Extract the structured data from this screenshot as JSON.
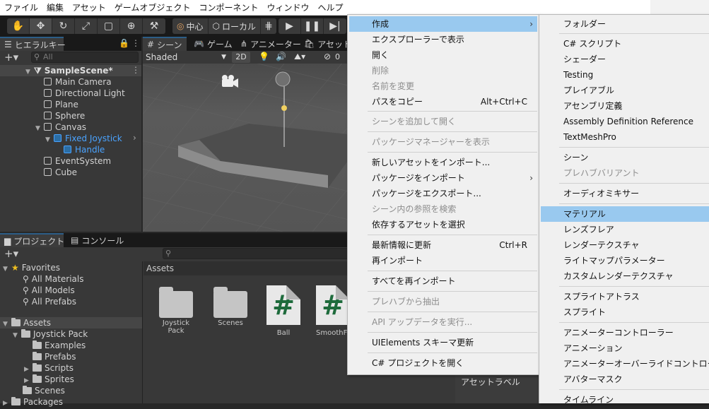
{
  "menubar": {
    "items": [
      "ファイル",
      "編集",
      "アセット",
      "ゲームオブジェクト",
      "コンポーネント",
      "ウィンドウ",
      "ヘルプ"
    ]
  },
  "toolbar": {
    "pivot_label": "中心",
    "space_label": "ローカル"
  },
  "hierarchy": {
    "tab": "ヒエラルキー",
    "search_placeholder": "All",
    "scene_name": "SampleScene*",
    "items": [
      {
        "label": "Main Camera"
      },
      {
        "label": "Directional Light"
      },
      {
        "label": "Plane"
      },
      {
        "label": "Sphere"
      },
      {
        "label": "Canvas"
      },
      {
        "label": "Fixed Joystick"
      },
      {
        "label": "Handle"
      },
      {
        "label": "EventSystem"
      },
      {
        "label": "Cube"
      }
    ]
  },
  "scene_view": {
    "tabs": [
      "シーン",
      "ゲーム",
      "アニメーター",
      "アセットス"
    ],
    "shading_mode": "Shaded",
    "mode_2d": "2D",
    "hidden_count": "0"
  },
  "project": {
    "tabs": [
      "プロジェクト",
      "コンソール"
    ],
    "favorites_label": "Favorites",
    "favorites": [
      "All Materials",
      "All Models",
      "All Prefabs"
    ],
    "assets_root": "Assets",
    "tree": [
      {
        "label": "Joystick Pack"
      },
      {
        "label": "Examples"
      },
      {
        "label": "Prefabs"
      },
      {
        "label": "Scripts"
      },
      {
        "label": "Sprites"
      },
      {
        "label": "Scenes"
      },
      {
        "label": "Packages"
      }
    ],
    "breadcrumb": "Assets",
    "assets": [
      {
        "name": "Joystick Pack",
        "icon": "folder-icon"
      },
      {
        "name": "Scenes",
        "icon": "folder-icon"
      },
      {
        "name": "Ball",
        "icon": "csharp-script-icon"
      },
      {
        "name": "SmoothFo",
        "icon": "csharp-script-icon"
      }
    ],
    "script_glyph": "#"
  },
  "inspector_label": "アセットラベル",
  "context_menu": {
    "items": [
      {
        "label": "作成",
        "shortcut": "",
        "disabled": false,
        "submenu": true,
        "highlighted": true
      },
      {
        "label": "エクスプローラーで表示",
        "shortcut": "",
        "disabled": false
      },
      {
        "label": "開く",
        "shortcut": "",
        "disabled": false
      },
      {
        "label": "削除",
        "shortcut": "",
        "disabled": true
      },
      {
        "label": "名前を変更",
        "shortcut": "",
        "disabled": true
      },
      {
        "label": "パスをコピー",
        "shortcut": "Alt+Ctrl+C",
        "disabled": false
      },
      {
        "label": "シーンを追加して開く",
        "shortcut": "",
        "disabled": true
      },
      {
        "label": "パッケージマネージャーを表示",
        "shortcut": "",
        "disabled": true
      },
      {
        "label": "新しいアセットをインポート...",
        "shortcut": "",
        "disabled": false
      },
      {
        "label": "パッケージをインポート",
        "shortcut": "",
        "disabled": false,
        "submenu": true
      },
      {
        "label": "パッケージをエクスポート...",
        "shortcut": "",
        "disabled": false
      },
      {
        "label": "シーン内の参照を検索",
        "shortcut": "",
        "disabled": true
      },
      {
        "label": "依存するアセットを選択",
        "shortcut": "",
        "disabled": false
      },
      {
        "label": "最新情報に更新",
        "shortcut": "Ctrl+R",
        "disabled": false
      },
      {
        "label": "再インポート",
        "shortcut": "",
        "disabled": false
      },
      {
        "label": "すべてを再インポート",
        "shortcut": "",
        "disabled": false
      },
      {
        "label": "プレハブから抽出",
        "shortcut": "",
        "disabled": true
      },
      {
        "label": "API アップデータを実行...",
        "shortcut": "",
        "disabled": true
      },
      {
        "label": "UIElements スキーマ更新",
        "shortcut": "",
        "disabled": false
      },
      {
        "label": "C# プロジェクトを開く",
        "shortcut": "",
        "disabled": false
      }
    ]
  },
  "create_submenu": {
    "items": [
      {
        "label": "フォルダー",
        "disabled": false
      },
      {
        "label": "C# スクリプト",
        "disabled": false
      },
      {
        "label": "シェーダー",
        "disabled": false
      },
      {
        "label": "Testing",
        "disabled": false
      },
      {
        "label": "プレイアブル",
        "disabled": false
      },
      {
        "label": "アセンブリ定義",
        "disabled": false
      },
      {
        "label": "Assembly Definition Reference",
        "disabled": false
      },
      {
        "label": "TextMeshPro",
        "disabled": false
      },
      {
        "label": "シーン",
        "disabled": false
      },
      {
        "label": "プレハブバリアント",
        "disabled": true
      },
      {
        "label": "オーディオミキサー",
        "disabled": false
      },
      {
        "label": "マテリアル",
        "disabled": false,
        "highlighted": true
      },
      {
        "label": "レンズフレア",
        "disabled": false
      },
      {
        "label": "レンダーテクスチャ",
        "disabled": false
      },
      {
        "label": "ライトマップパラメーター",
        "disabled": false
      },
      {
        "label": "カスタムレンダーテクスチャ",
        "disabled": false
      },
      {
        "label": "スプライトアトラス",
        "disabled": false
      },
      {
        "label": "スプライト",
        "disabled": false
      },
      {
        "label": "アニメーターコントローラー",
        "disabled": false
      },
      {
        "label": "アニメーション",
        "disabled": false
      },
      {
        "label": "アニメーターオーバーライドコントローラー",
        "disabled": false
      },
      {
        "label": "アバターマスク",
        "disabled": false
      },
      {
        "label": "タイムライン",
        "disabled": false
      }
    ]
  },
  "colors": {
    "highlight": "#99c9ef",
    "selected_text": "#4aa3ff",
    "accent": "#2c5d87"
  }
}
